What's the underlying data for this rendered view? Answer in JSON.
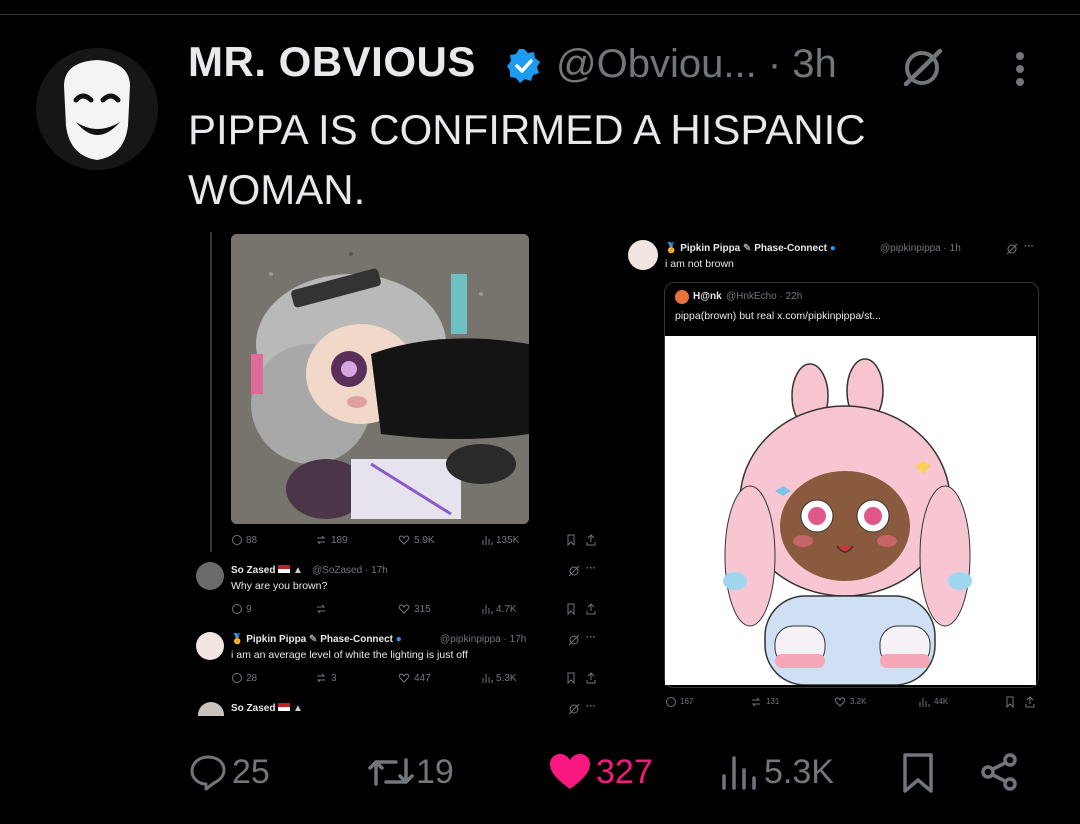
{
  "post": {
    "author_name": "MR. OBVIOUS",
    "author_handle": "@Obviou...",
    "time": "· 3h",
    "text": "PIPPA IS CONFIRMED A HISPANIC\nWOMAN.",
    "icons": [
      "verified-badge-icon",
      "grok-icon",
      "more-icon"
    ]
  },
  "left_screenshot": {
    "first_tweet_stats": {
      "replies": "88",
      "reposts": "189",
      "likes": "5.9K",
      "views": "135K"
    },
    "reply1": {
      "name": "So Zased",
      "handle": "@SoZased · 17h",
      "text": "Why are you brown?",
      "replies": "9",
      "reposts": "",
      "likes": "315",
      "views": "4.7K"
    },
    "reply2": {
      "name": "Pipkin Pippa",
      "affiliation": "Phase-Connect",
      "handle": "@pipkinpippa · 17h",
      "text": "i am an average level of white the lighting is just off",
      "replies": "28",
      "reposts": "3",
      "likes": "447",
      "views": "5.3K"
    },
    "reply3": {
      "name": "So Zased"
    }
  },
  "right_screenshot": {
    "name": "Pipkin Pippa",
    "affiliation": "Phase-Connect",
    "handle": "@pipkinpippa · 1h",
    "text": "i am not brown",
    "quoted": {
      "name": "H@nk",
      "handle": "@HnkEcho · 22h",
      "text": "pippa(brown) but real x.com/pipkinpippa/st..."
    },
    "stats": {
      "replies": "167",
      "reposts": "131",
      "likes": "3.2K",
      "views": "44K"
    }
  },
  "actions": {
    "replies": "25",
    "reposts": "19",
    "likes": "327",
    "views": "5.3K"
  },
  "colors": {
    "background": "#000000",
    "text": "#e7e9ea",
    "muted": "#71767b",
    "like": "#f91880",
    "verified": "#1d9bf0"
  }
}
